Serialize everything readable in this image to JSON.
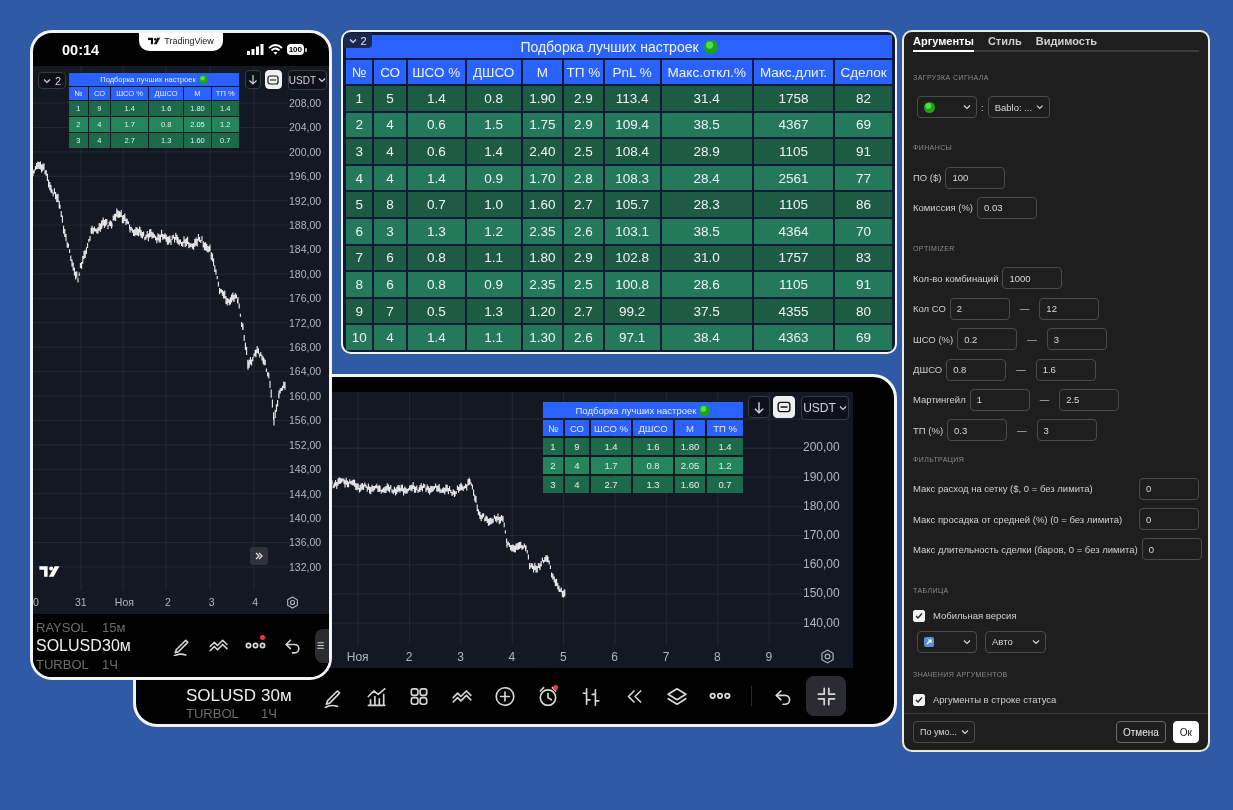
{
  "phone": {
    "status_bar": {
      "time": "00:14",
      "battery": "100"
    },
    "island": {
      "label": "TradingView"
    },
    "indicator_count": "2",
    "results": {
      "title": "Подборка лучших настроек",
      "columns": [
        "№",
        "СО",
        "ШСО %",
        "ДШСО",
        "М",
        "ТП %"
      ],
      "rows": [
        [
          "1",
          "9",
          "1.4",
          "1.6",
          "1.80",
          "1.4"
        ],
        [
          "2",
          "4",
          "1.7",
          "0.8",
          "2.05",
          "1.2"
        ],
        [
          "3",
          "4",
          "2.7",
          "1.3",
          "1.60",
          "0.7"
        ]
      ]
    },
    "currency": "USDT",
    "price_labels": [
      "208,00",
      "204,00",
      "200,00",
      "196,00",
      "192,00",
      "188,00",
      "184,00",
      "180,00",
      "176,00",
      "172,00",
      "168,00",
      "164,00",
      "160,00",
      "156,00",
      "152,00",
      "148,00",
      "144,00",
      "140,00",
      "136,00",
      "132,00"
    ],
    "date_labels": [
      "0",
      "31",
      "Ноя",
      "2",
      "3",
      "4"
    ],
    "symbols": [
      {
        "symbol": "RAYSOL",
        "interval": "15м",
        "selected": false
      },
      {
        "symbol": "SOLUSD",
        "interval": "30м",
        "selected": true
      },
      {
        "symbol": "TURBOL",
        "interval": "1Ч",
        "selected": false
      }
    ],
    "toolbar": [
      {
        "kind": "pen",
        "alert": false,
        "active": false
      },
      {
        "kind": "lines",
        "alert": false,
        "active": false
      },
      {
        "kind": "more",
        "alert": true,
        "active": false
      },
      {
        "kind": "undo",
        "alert": false,
        "active": false
      },
      {
        "kind": "panel",
        "alert": false,
        "active": true
      }
    ]
  },
  "results": {
    "indicator_count": "2",
    "title": "Подборка лучших настроек",
    "columns": [
      "№",
      "СО",
      "ШСО %",
      "ДШСО",
      "М",
      "ТП %",
      "PnL %",
      "Макс.откл.%",
      "Макс.длит.",
      "Сделок"
    ],
    "rows": [
      [
        "1",
        "5",
        "1.4",
        "0.8",
        "1.90",
        "2.9",
        "113.4",
        "31.4",
        "1758",
        "82"
      ],
      [
        "2",
        "4",
        "0.6",
        "1.5",
        "1.75",
        "2.9",
        "109.4",
        "38.5",
        "4367",
        "69"
      ],
      [
        "3",
        "4",
        "0.6",
        "1.4",
        "2.40",
        "2.5",
        "108.4",
        "28.9",
        "1105",
        "91"
      ],
      [
        "4",
        "4",
        "1.4",
        "0.9",
        "1.70",
        "2.8",
        "108.3",
        "28.4",
        "2561",
        "77"
      ],
      [
        "5",
        "8",
        "0.7",
        "1.0",
        "1.60",
        "2.7",
        "105.7",
        "28.3",
        "1105",
        "86"
      ],
      [
        "6",
        "3",
        "1.3",
        "1.2",
        "2.35",
        "2.6",
        "103.1",
        "38.5",
        "4364",
        "70"
      ],
      [
        "7",
        "6",
        "0.8",
        "1.1",
        "1.80",
        "2.9",
        "102.8",
        "31.0",
        "1757",
        "83"
      ],
      [
        "8",
        "6",
        "0.8",
        "0.9",
        "2.35",
        "2.5",
        "100.8",
        "28.6",
        "1105",
        "91"
      ],
      [
        "9",
        "7",
        "0.5",
        "1.3",
        "1.20",
        "2.7",
        "99.2",
        "37.5",
        "4355",
        "80"
      ],
      [
        "10",
        "4",
        "1.4",
        "1.1",
        "1.30",
        "2.6",
        "97.1",
        "38.4",
        "4363",
        "69"
      ]
    ]
  },
  "tablet": {
    "results": {
      "title": "Подборка лучших настроек",
      "columns": [
        "№",
        "СО",
        "ШСО %",
        "ДШСО",
        "М",
        "ТП %"
      ],
      "rows": [
        [
          "1",
          "9",
          "1.4",
          "1.6",
          "1.80",
          "1.4"
        ],
        [
          "2",
          "4",
          "1.7",
          "0.8",
          "2.05",
          "1.2"
        ],
        [
          "3",
          "4",
          "2.7",
          "1.3",
          "1.60",
          "0.7"
        ]
      ]
    },
    "currency": "USDT",
    "price_labels": [
      "200,00",
      "190,00",
      "180,00",
      "170,00",
      "160,00",
      "150,00",
      "140,00"
    ],
    "date_labels": [
      "Ноя",
      "2",
      "3",
      "4",
      "5",
      "6",
      "7",
      "8",
      "9"
    ],
    "symbols": [
      {
        "symbol": "SOLUSD",
        "interval": "30м",
        "selected": true
      },
      {
        "symbol": "TURBOL",
        "interval": "1Ч",
        "selected": false
      }
    ],
    "toolbar": [
      {
        "kind": "pen",
        "alert": false,
        "active": false
      },
      {
        "kind": "indicators",
        "alert": false,
        "active": false
      },
      {
        "kind": "grid",
        "alert": false,
        "active": false
      },
      {
        "kind": "lines",
        "alert": false,
        "active": false
      },
      {
        "kind": "plus",
        "alert": false,
        "active": false
      },
      {
        "kind": "alarm",
        "alert": true,
        "active": false
      },
      {
        "kind": "bars",
        "alert": false,
        "active": false
      },
      {
        "kind": "rewind",
        "alert": false,
        "active": false
      },
      {
        "kind": "layers",
        "alert": false,
        "active": false
      },
      {
        "kind": "more",
        "alert": false,
        "active": false
      },
      {
        "kind": "divider"
      },
      {
        "kind": "undo",
        "alert": false,
        "active": false
      },
      {
        "kind": "shrink",
        "alert": false,
        "active": true
      }
    ]
  },
  "settings": {
    "tabs": [
      {
        "label": "Аргументы",
        "selected": true
      },
      {
        "label": "Стиль",
        "selected": false
      },
      {
        "label": "Видимость",
        "selected": false
      }
    ],
    "sections": [
      {
        "heading": "ЗАГРУЗКА СИГНАЛА",
        "fields": [
          {
            "kind": "source",
            "separator": ":",
            "value": "Bablo: ..."
          }
        ]
      },
      {
        "heading": "ФИНАНСЫ",
        "fields": [
          {
            "kind": "input",
            "label": "ПО ($)",
            "value": "100"
          },
          {
            "kind": "input",
            "label": "Комиссия (%)",
            "value": "0.03"
          }
        ]
      },
      {
        "heading": "OPTIMIZER",
        "fields": [
          {
            "kind": "input",
            "label": "Кол-во комбинаций",
            "value": "1000"
          },
          {
            "kind": "range",
            "label": "Кол СО",
            "from": "2",
            "separator": "—",
            "to": "12"
          },
          {
            "kind": "range",
            "label": "ШСО (%)",
            "from": "0.2",
            "separator": "—",
            "to": "3"
          },
          {
            "kind": "range",
            "label": "ДШСО",
            "from": "0.8",
            "separator": "—",
            "to": "1.6"
          },
          {
            "kind": "range",
            "label": "Мартингейл",
            "from": "1",
            "separator": "—",
            "to": "2.5"
          },
          {
            "kind": "range",
            "label": "ТП (%)",
            "from": "0.3",
            "separator": "—",
            "to": "3"
          }
        ]
      },
      {
        "heading": "ФИЛЬТРАЦИЯ",
        "fields": [
          {
            "kind": "filter",
            "label": "Макс расход на сетку ($, 0 = без лимита)",
            "value": "0"
          },
          {
            "kind": "filter",
            "label": "Макс просадка от средней (%) (0 = без лимита)",
            "value": "0"
          },
          {
            "kind": "filter",
            "label": "Макс длительность сделки (баров, 0 = без лимита)",
            "value": "0"
          }
        ]
      },
      {
        "heading": "ТАБЛИЦА",
        "fields": [
          {
            "kind": "checkbox",
            "label": "Мобильная версия",
            "checked": true
          },
          {
            "kind": "selects",
            "value": "Авто"
          }
        ]
      },
      {
        "heading": "ЗНАЧЕНИЯ АРГУМЕНТОВ",
        "fields": [
          {
            "kind": "checkbox",
            "label": "Аргументы в строке статуса",
            "checked": true
          }
        ]
      }
    ],
    "footer": {
      "preset": "По умо...",
      "cancel": "Отмена",
      "ok": "Ок"
    }
  }
}
